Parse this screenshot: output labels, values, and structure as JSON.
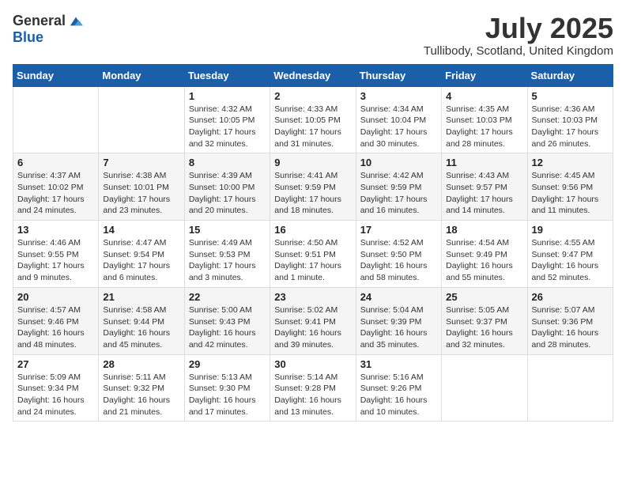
{
  "header": {
    "logo_general": "General",
    "logo_blue": "Blue",
    "title": "July 2025",
    "location": "Tullibody, Scotland, United Kingdom"
  },
  "days_of_week": [
    "Sunday",
    "Monday",
    "Tuesday",
    "Wednesday",
    "Thursday",
    "Friday",
    "Saturday"
  ],
  "weeks": [
    [
      {
        "day": "",
        "info": ""
      },
      {
        "day": "",
        "info": ""
      },
      {
        "day": "1",
        "info": "Sunrise: 4:32 AM\nSunset: 10:05 PM\nDaylight: 17 hours and 32 minutes."
      },
      {
        "day": "2",
        "info": "Sunrise: 4:33 AM\nSunset: 10:05 PM\nDaylight: 17 hours and 31 minutes."
      },
      {
        "day": "3",
        "info": "Sunrise: 4:34 AM\nSunset: 10:04 PM\nDaylight: 17 hours and 30 minutes."
      },
      {
        "day": "4",
        "info": "Sunrise: 4:35 AM\nSunset: 10:03 PM\nDaylight: 17 hours and 28 minutes."
      },
      {
        "day": "5",
        "info": "Sunrise: 4:36 AM\nSunset: 10:03 PM\nDaylight: 17 hours and 26 minutes."
      }
    ],
    [
      {
        "day": "6",
        "info": "Sunrise: 4:37 AM\nSunset: 10:02 PM\nDaylight: 17 hours and 24 minutes."
      },
      {
        "day": "7",
        "info": "Sunrise: 4:38 AM\nSunset: 10:01 PM\nDaylight: 17 hours and 23 minutes."
      },
      {
        "day": "8",
        "info": "Sunrise: 4:39 AM\nSunset: 10:00 PM\nDaylight: 17 hours and 20 minutes."
      },
      {
        "day": "9",
        "info": "Sunrise: 4:41 AM\nSunset: 9:59 PM\nDaylight: 17 hours and 18 minutes."
      },
      {
        "day": "10",
        "info": "Sunrise: 4:42 AM\nSunset: 9:59 PM\nDaylight: 17 hours and 16 minutes."
      },
      {
        "day": "11",
        "info": "Sunrise: 4:43 AM\nSunset: 9:57 PM\nDaylight: 17 hours and 14 minutes."
      },
      {
        "day": "12",
        "info": "Sunrise: 4:45 AM\nSunset: 9:56 PM\nDaylight: 17 hours and 11 minutes."
      }
    ],
    [
      {
        "day": "13",
        "info": "Sunrise: 4:46 AM\nSunset: 9:55 PM\nDaylight: 17 hours and 9 minutes."
      },
      {
        "day": "14",
        "info": "Sunrise: 4:47 AM\nSunset: 9:54 PM\nDaylight: 17 hours and 6 minutes."
      },
      {
        "day": "15",
        "info": "Sunrise: 4:49 AM\nSunset: 9:53 PM\nDaylight: 17 hours and 3 minutes."
      },
      {
        "day": "16",
        "info": "Sunrise: 4:50 AM\nSunset: 9:51 PM\nDaylight: 17 hours and 1 minute."
      },
      {
        "day": "17",
        "info": "Sunrise: 4:52 AM\nSunset: 9:50 PM\nDaylight: 16 hours and 58 minutes."
      },
      {
        "day": "18",
        "info": "Sunrise: 4:54 AM\nSunset: 9:49 PM\nDaylight: 16 hours and 55 minutes."
      },
      {
        "day": "19",
        "info": "Sunrise: 4:55 AM\nSunset: 9:47 PM\nDaylight: 16 hours and 52 minutes."
      }
    ],
    [
      {
        "day": "20",
        "info": "Sunrise: 4:57 AM\nSunset: 9:46 PM\nDaylight: 16 hours and 48 minutes."
      },
      {
        "day": "21",
        "info": "Sunrise: 4:58 AM\nSunset: 9:44 PM\nDaylight: 16 hours and 45 minutes."
      },
      {
        "day": "22",
        "info": "Sunrise: 5:00 AM\nSunset: 9:43 PM\nDaylight: 16 hours and 42 minutes."
      },
      {
        "day": "23",
        "info": "Sunrise: 5:02 AM\nSunset: 9:41 PM\nDaylight: 16 hours and 39 minutes."
      },
      {
        "day": "24",
        "info": "Sunrise: 5:04 AM\nSunset: 9:39 PM\nDaylight: 16 hours and 35 minutes."
      },
      {
        "day": "25",
        "info": "Sunrise: 5:05 AM\nSunset: 9:37 PM\nDaylight: 16 hours and 32 minutes."
      },
      {
        "day": "26",
        "info": "Sunrise: 5:07 AM\nSunset: 9:36 PM\nDaylight: 16 hours and 28 minutes."
      }
    ],
    [
      {
        "day": "27",
        "info": "Sunrise: 5:09 AM\nSunset: 9:34 PM\nDaylight: 16 hours and 24 minutes."
      },
      {
        "day": "28",
        "info": "Sunrise: 5:11 AM\nSunset: 9:32 PM\nDaylight: 16 hours and 21 minutes."
      },
      {
        "day": "29",
        "info": "Sunrise: 5:13 AM\nSunset: 9:30 PM\nDaylight: 16 hours and 17 minutes."
      },
      {
        "day": "30",
        "info": "Sunrise: 5:14 AM\nSunset: 9:28 PM\nDaylight: 16 hours and 13 minutes."
      },
      {
        "day": "31",
        "info": "Sunrise: 5:16 AM\nSunset: 9:26 PM\nDaylight: 16 hours and 10 minutes."
      },
      {
        "day": "",
        "info": ""
      },
      {
        "day": "",
        "info": ""
      }
    ]
  ]
}
